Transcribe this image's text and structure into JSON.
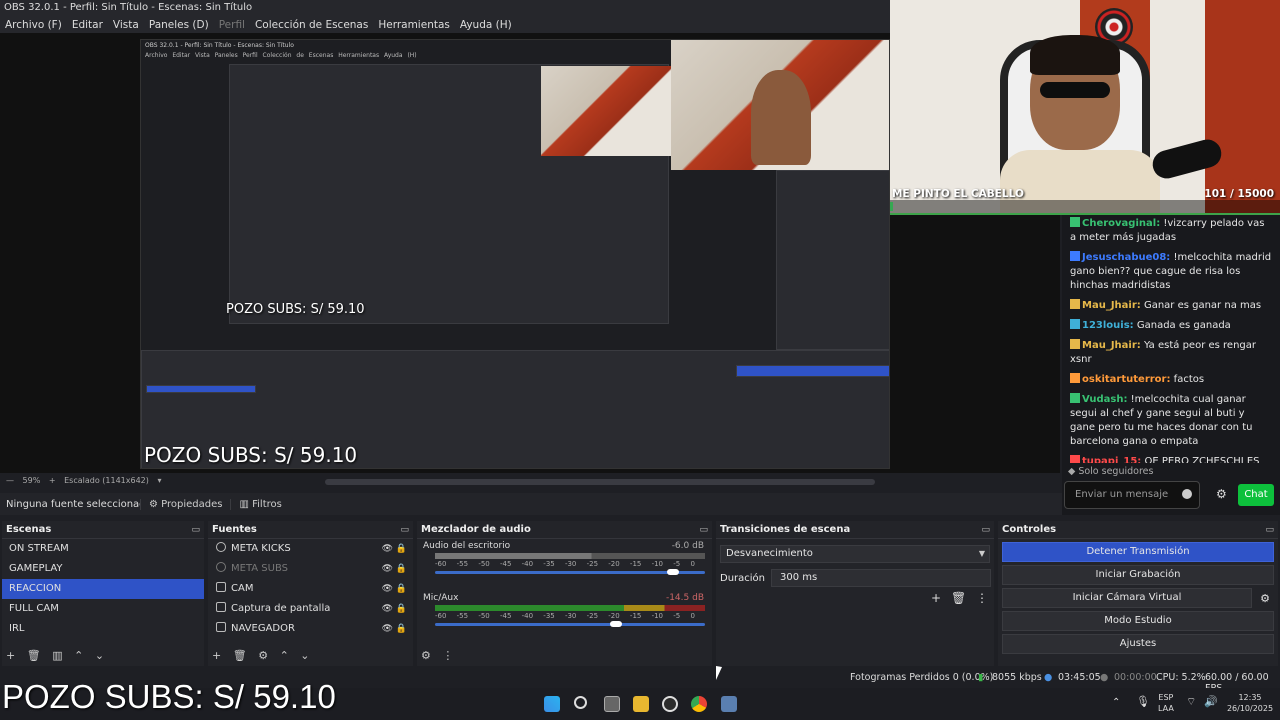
{
  "window": {
    "title": "OBS 32.0.1 - Perfil: Sin Título - Escenas: Sin Título"
  },
  "menu": [
    "Archivo (F)",
    "Editar",
    "Vista",
    "Paneles (D)",
    "Perfil",
    "Colección de Escenas",
    "Herramientas",
    "Ayuda (H)"
  ],
  "preview": {
    "inner_title": "OBS 32.0.1 - Perfil: Sin Título - Escenas: Sin Título",
    "inner_menu": "Archivo Editar Vista Paneles Perfil Colección de Escenas Herramientas Ayuda (H)",
    "pozo_text": "POZO SUBS: S/ 59.10",
    "inner_zoom": "59%",
    "inner_scale": "Escalado (1141x642)"
  },
  "webcam": {
    "label": "ME PINTO EL CABELLO",
    "count": "101 / 15000",
    "progress_fraction": 0.0067
  },
  "chat": {
    "messages": [
      {
        "user": "Cherovaginal:",
        "text": " !vizcarry pelado vas a meter más jugadas",
        "color": "#38c172"
      },
      {
        "user": "Jesuschabue08:",
        "text": " !melcochita madrid gano bien?? que cague de risa los hinchas madridistas",
        "color": "#3d7bff"
      },
      {
        "user": "Mau_Jhair:",
        "text": " Ganar es ganar na mas",
        "color": "#e6b84a"
      },
      {
        "user": "123louis:",
        "text": " Ganada es ganada",
        "color": "#3fb0d8"
      },
      {
        "user": "Mau_Jhair:",
        "text": " Ya está peor es rengar xsnr",
        "color": "#e6b84a"
      },
      {
        "user": "oskitartuterror:",
        "text": " factos",
        "color": "#ff9a3a"
      },
      {
        "user": "Vudash:",
        "text": " !melcochita cual ganar segui al chef y gane segui al buti y gane pero tu me haces donar con tu barcelona gana o empata",
        "color": "#38c172"
      },
      {
        "user": "tupapi_15:",
        "text": " OE PERO ZCHESCHI ES EL Q SALVO LOS GOLES",
        "color": "#ff4a4a"
      }
    ],
    "followers_only": "Solo seguidores",
    "input_placeholder": "Enviar un mensaje",
    "send_label": "Chat"
  },
  "zoom": {
    "percent": "59%",
    "scale": "Escalado (1141x642)"
  },
  "props": {
    "none_selected": "Ninguna fuente seleccionada",
    "properties": "Propiedades",
    "filters": "Filtros"
  },
  "scenes": {
    "title": "Escenas",
    "items": [
      "ON STREAM",
      "GAMEPLAY",
      "REACCION",
      "FULL CAM",
      "IRL"
    ],
    "selected": 2
  },
  "sources": {
    "title": "Fuentes",
    "items": [
      "META KICKS",
      "META SUBS",
      "CAM",
      "Captura de pantalla",
      "NAVEGADOR"
    ]
  },
  "mixer": {
    "title": "Mezclador de audio",
    "channels": [
      {
        "name": "Audio del escritorio",
        "db": "-6.0 dB",
        "volume": 0.88
      },
      {
        "name": "Mic/Aux",
        "db": "-14.5 dB",
        "volume": 0.67
      }
    ],
    "scale": [
      "-60",
      "-55",
      "-50",
      "-45",
      "-40",
      "-35",
      "-30",
      "-25",
      "-20",
      "-15",
      "-10",
      "-5",
      "0"
    ]
  },
  "transitions": {
    "title": "Transiciones de escena",
    "selected": "Desvanecimiento",
    "duration_label": "Duración",
    "duration": "300 ms"
  },
  "controls": {
    "title": "Controles",
    "buttons": [
      "Detener Transmisión",
      "Iniciar Grabación",
      "Iniciar Cámara Virtual",
      "Modo Estudio",
      "Ajustes"
    ]
  },
  "status": {
    "dropped": "Fotogramas Perdidos 0 (0.0%)",
    "bitrate": "8055 kbps",
    "stream_time": "03:45:05",
    "rec_time": "00:00:00",
    "cpu": "CPU: 5.2%",
    "fps": "60.00 / 60.00 FPS"
  },
  "overlay": {
    "pozo": "POZO SUBS: S/ 59.10"
  },
  "taskbar": {
    "lang": "ESP",
    "lang2": "LAA",
    "time": "12:35",
    "date": "26/10/2025"
  }
}
